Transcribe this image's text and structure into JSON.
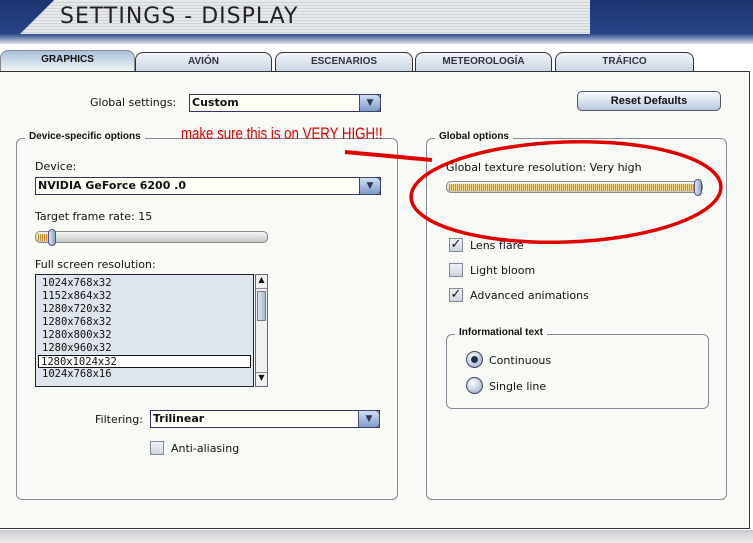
{
  "header": {
    "title": "SETTINGS - DISPLAY"
  },
  "tabs": [
    {
      "label": "GRAPHICS",
      "active": true
    },
    {
      "label": "AVIÓN"
    },
    {
      "label": "ESCENARIOS"
    },
    {
      "label": "METEOROLOGÍA"
    },
    {
      "label": "TRÁFICO"
    }
  ],
  "global_settings": {
    "label": "Global settings:",
    "value": "Custom"
  },
  "reset_button": "Reset Defaults",
  "annotation": "make sure this is on VERY HIGH!!",
  "device_group": {
    "legend": "Device-specific options",
    "device_label": "Device:",
    "device_value": "NVIDIA GeForce 6200 .0",
    "frame_rate_label": "Target frame rate: 15",
    "frame_rate_fraction": 0.05,
    "resolution_label": "Full screen resolution:",
    "resolutions": [
      "1024x768x32",
      "1152x864x32",
      "1280x720x32",
      "1280x768x32",
      "1280x800x32",
      "1280x960x32",
      "1280x1024x32",
      "1024x768x16"
    ],
    "selected_resolution": "1280x1024x32",
    "filtering_label": "Filtering:",
    "filtering_value": "Trilinear",
    "antialiasing_label": "Anti-aliasing",
    "antialiasing_checked": false
  },
  "global_group": {
    "legend": "Global options",
    "texture_label": "Global texture resolution: Very high",
    "texture_fraction": 1.0,
    "lens_flare": {
      "label": "Lens flare",
      "checked": true
    },
    "light_bloom": {
      "label": "Light bloom",
      "checked": false
    },
    "advanced_animations": {
      "label": "Advanced animations",
      "checked": true
    },
    "info_text": {
      "legend": "Informational text",
      "options": [
        "Continuous",
        "Single line"
      ],
      "selected": "Continuous"
    }
  },
  "colors": {
    "annotation": "#e00000",
    "header": "#1d3470"
  }
}
